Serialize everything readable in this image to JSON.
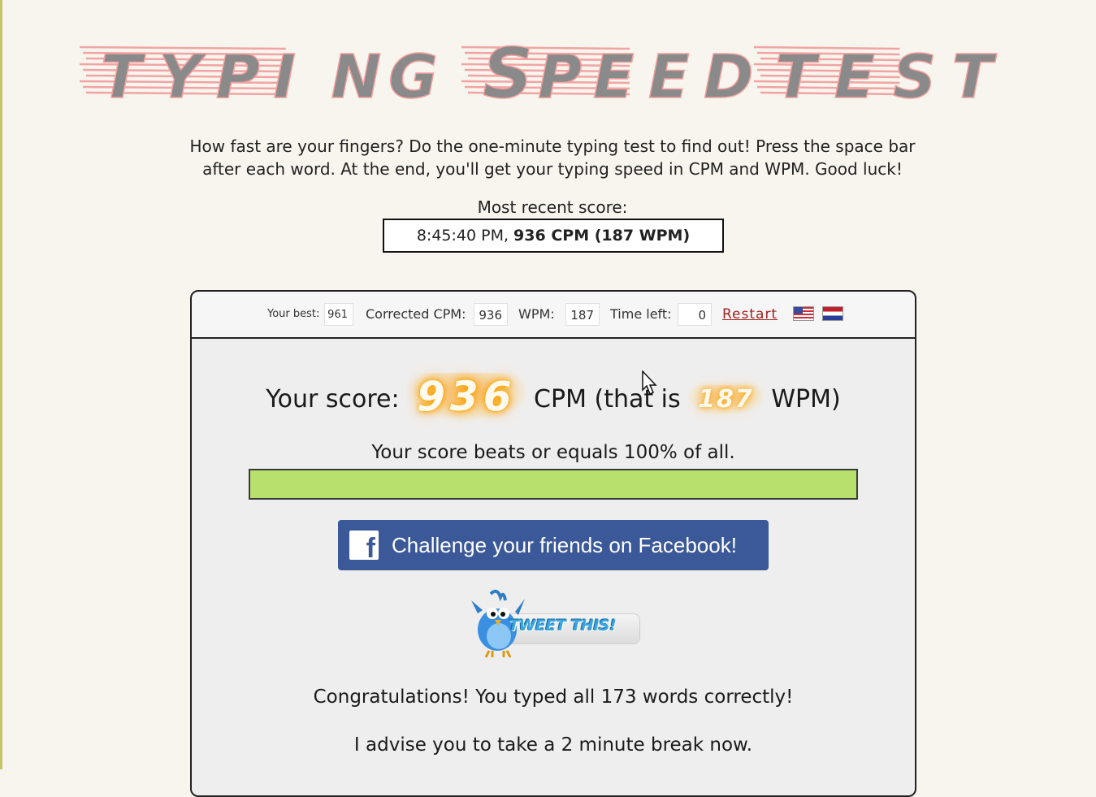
{
  "title": "Typing Speed Test",
  "title_letters": [
    "T",
    "Y",
    "P",
    "I",
    "N",
    "G",
    "S",
    "P",
    "E",
    "E",
    "D",
    "T",
    "E",
    "S",
    "T"
  ],
  "intro": "How fast are your fingers? Do the one-minute typing test to find out! Press the space bar after each word. At the end, you'll get your typing speed in CPM and WPM. Good luck!",
  "recent": {
    "label": "Most recent score:",
    "time": "8:45:40 PM, ",
    "score": "936 CPM (187 WPM)"
  },
  "toolbar": {
    "best_label": "Your best:",
    "best_value": "961",
    "cpm_label": "Corrected CPM:",
    "cpm_value": "936",
    "wpm_label": "WPM:",
    "wpm_value": "187",
    "time_label": "Time left:",
    "time_value": "0",
    "restart_label": "Restart",
    "flags": [
      "us-flag-icon",
      "nl-flag-icon"
    ]
  },
  "result": {
    "prefix": "Your score:",
    "cpm": "936",
    "middle": "CPM (that is",
    "wpm": "187",
    "suffix": "WPM)",
    "beats_text": "Your score beats or equals 100% of all.",
    "percentile": 100
  },
  "share": {
    "facebook_label": "Challenge your friends on Facebook!",
    "tweet_label": "TWEET THIS!"
  },
  "messages": {
    "congrats": "Congratulations! You typed all 173 words correctly!",
    "advise": "I advise you to take a 2 minute break now."
  },
  "colors": {
    "background": "#f7f5ee",
    "progress_fill": "#b8e06c",
    "facebook_blue": "#3b5998",
    "restart_link": "#a02020"
  }
}
